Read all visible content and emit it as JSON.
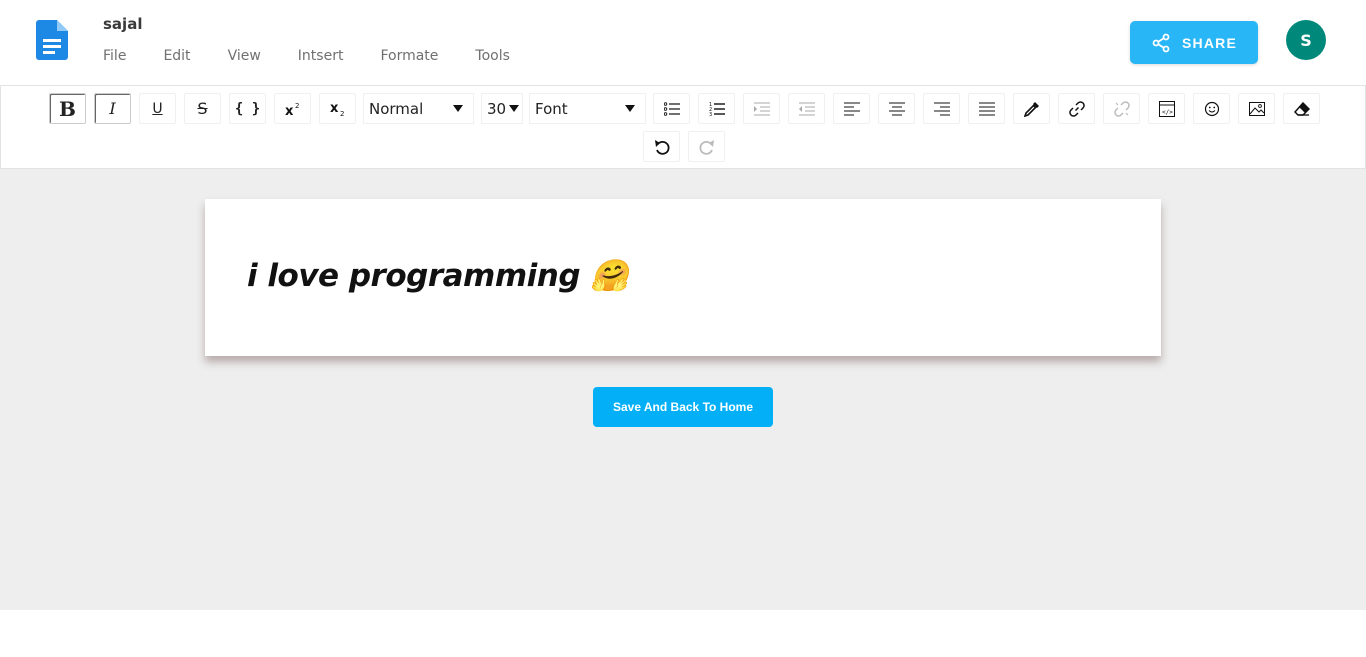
{
  "header": {
    "doc_title": "sajal",
    "menu": [
      {
        "label": "File"
      },
      {
        "label": "Edit"
      },
      {
        "label": "View"
      },
      {
        "label": "Intsert"
      },
      {
        "label": "Formate"
      },
      {
        "label": "Tools"
      }
    ],
    "share_label": "SHARE",
    "avatar_initial": "S",
    "colors": {
      "share": "#29b6f6",
      "avatar": "#00897b",
      "doc_icon": "#1e88e5"
    }
  },
  "toolbar": {
    "bold": "B",
    "italic": "I",
    "underline": "U",
    "strike": "S",
    "code": "{ }",
    "block_type": "Normal",
    "font_size": "30",
    "font_family": "Font"
  },
  "editor": {
    "content": "i love programming 🤗"
  },
  "save_button_label": "Save And Back To Home"
}
